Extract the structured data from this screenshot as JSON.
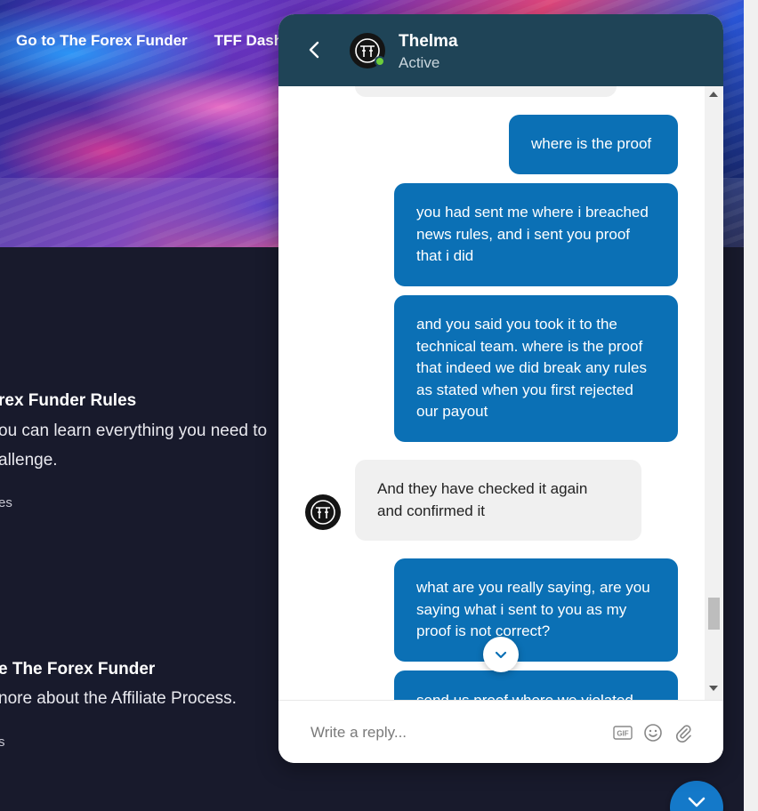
{
  "nav": {
    "item1": "Go to The Forex Funder",
    "item2": "TFF Dashb"
  },
  "sections": {
    "rules_title": "rex Funder Rules",
    "rules_line1": "ou can learn everything you need to",
    "rules_line2": "allenge.",
    "rules_meta": "es",
    "affiliate_title": "e The Forex Funder",
    "affiliate_line1": "nore about the Affiliate Process.",
    "affiliate_meta": "s"
  },
  "chat": {
    "agent_name": "Thelma",
    "agent_status": "Active",
    "messages": [
      {
        "from": "user",
        "text": "where is the proof"
      },
      {
        "from": "user",
        "text": "you had sent me where i breached\nnews rules, and i sent you proof\nthat i did"
      },
      {
        "from": "user",
        "text": "and you said you took it to the\ntechnical team. where is the proof\nthat indeed we did break any rules\nas stated when you first rejected\nour payout"
      },
      {
        "from": "agent",
        "text": "And they have checked it again\nand confirmed it"
      },
      {
        "from": "user",
        "text": "what are you really saying, are you\nsaying what i sent to you as my\nproof is not correct?"
      },
      {
        "from": "user",
        "text": "send us proof where we violated"
      }
    ],
    "composer_placeholder": "Write a reply...",
    "gif_label": "GIF"
  },
  "colors": {
    "header": "#1f4457",
    "outgoing_bubble": "#0b70b5",
    "incoming_bubble": "#f0f0f0",
    "online": "#6ccd3b",
    "fab": "#1479c9"
  },
  "icons": {
    "back": "chevron-left-icon",
    "avatar": "tff-logo-icon",
    "jump": "chevron-down-icon",
    "gif": "gif-icon",
    "emoji": "smiley-icon",
    "attach": "paperclip-icon"
  }
}
